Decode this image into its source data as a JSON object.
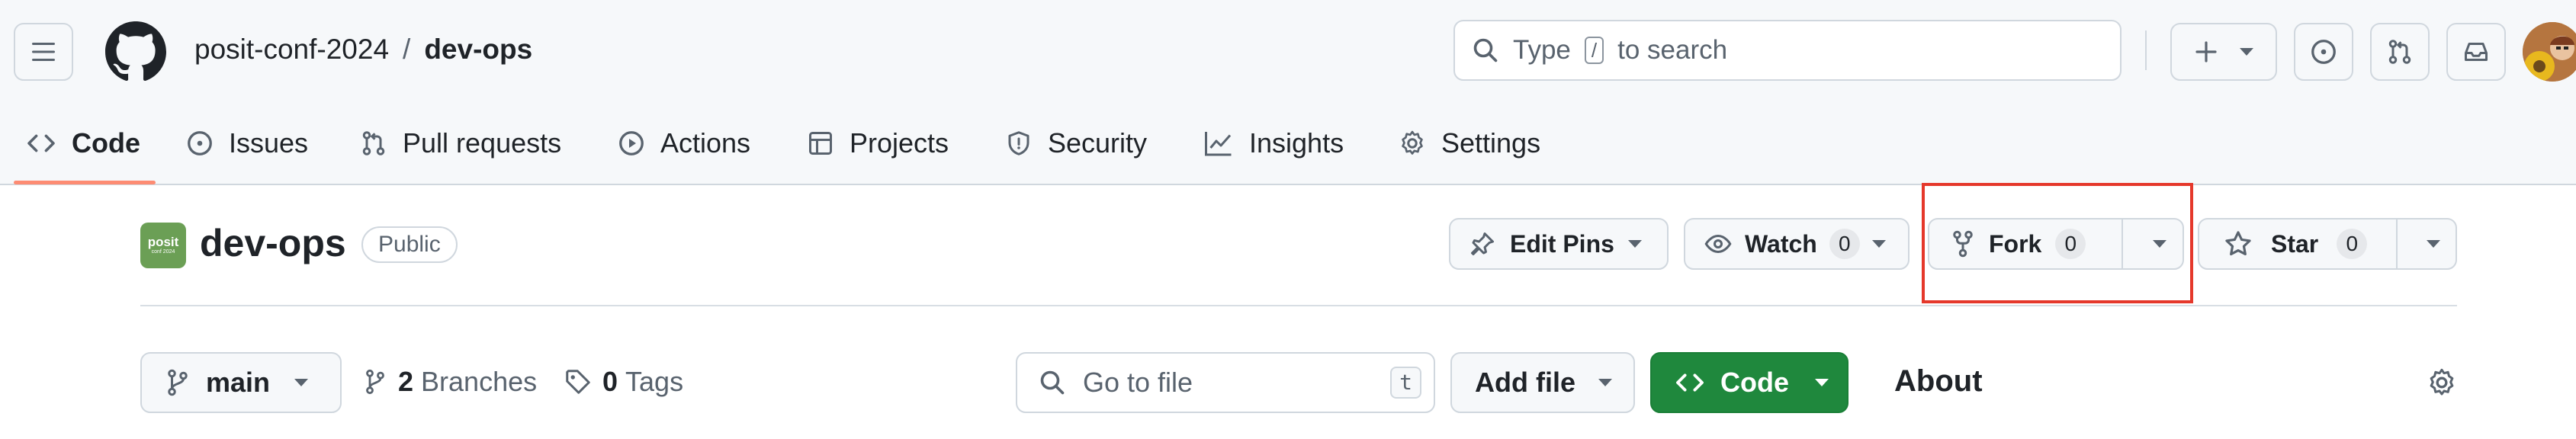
{
  "header": {
    "owner": "posit-conf-2024",
    "separator": "/",
    "repo": "dev-ops",
    "search_prefix": "Type",
    "search_key": "/",
    "search_suffix": "to search"
  },
  "tabs": [
    {
      "label": "Code"
    },
    {
      "label": "Issues"
    },
    {
      "label": "Pull requests"
    },
    {
      "label": "Actions"
    },
    {
      "label": "Projects"
    },
    {
      "label": "Security"
    },
    {
      "label": "Insights"
    },
    {
      "label": "Settings"
    }
  ],
  "repo_title": {
    "logo_text": "posit",
    "logo_subtext": "conf 2024",
    "name": "dev-ops",
    "visibility": "Public"
  },
  "actions": {
    "edit_pins": "Edit Pins",
    "watch": "Watch",
    "watch_count": "0",
    "fork": "Fork",
    "fork_count": "0",
    "star": "Star",
    "star_count": "0"
  },
  "file_bar": {
    "branch": "main",
    "branches_count": "2",
    "branches_label": "Branches",
    "tags_count": "0",
    "tags_label": "Tags",
    "goto_placeholder": "Go to file",
    "goto_key": "t",
    "add_file": "Add file",
    "code_button": "Code"
  },
  "about": {
    "title": "About"
  },
  "colors": {
    "accent_underline": "#fd8c73",
    "code_green": "#1f883d",
    "highlight_red": "#e5382b",
    "logo_green": "#6b9f55"
  }
}
